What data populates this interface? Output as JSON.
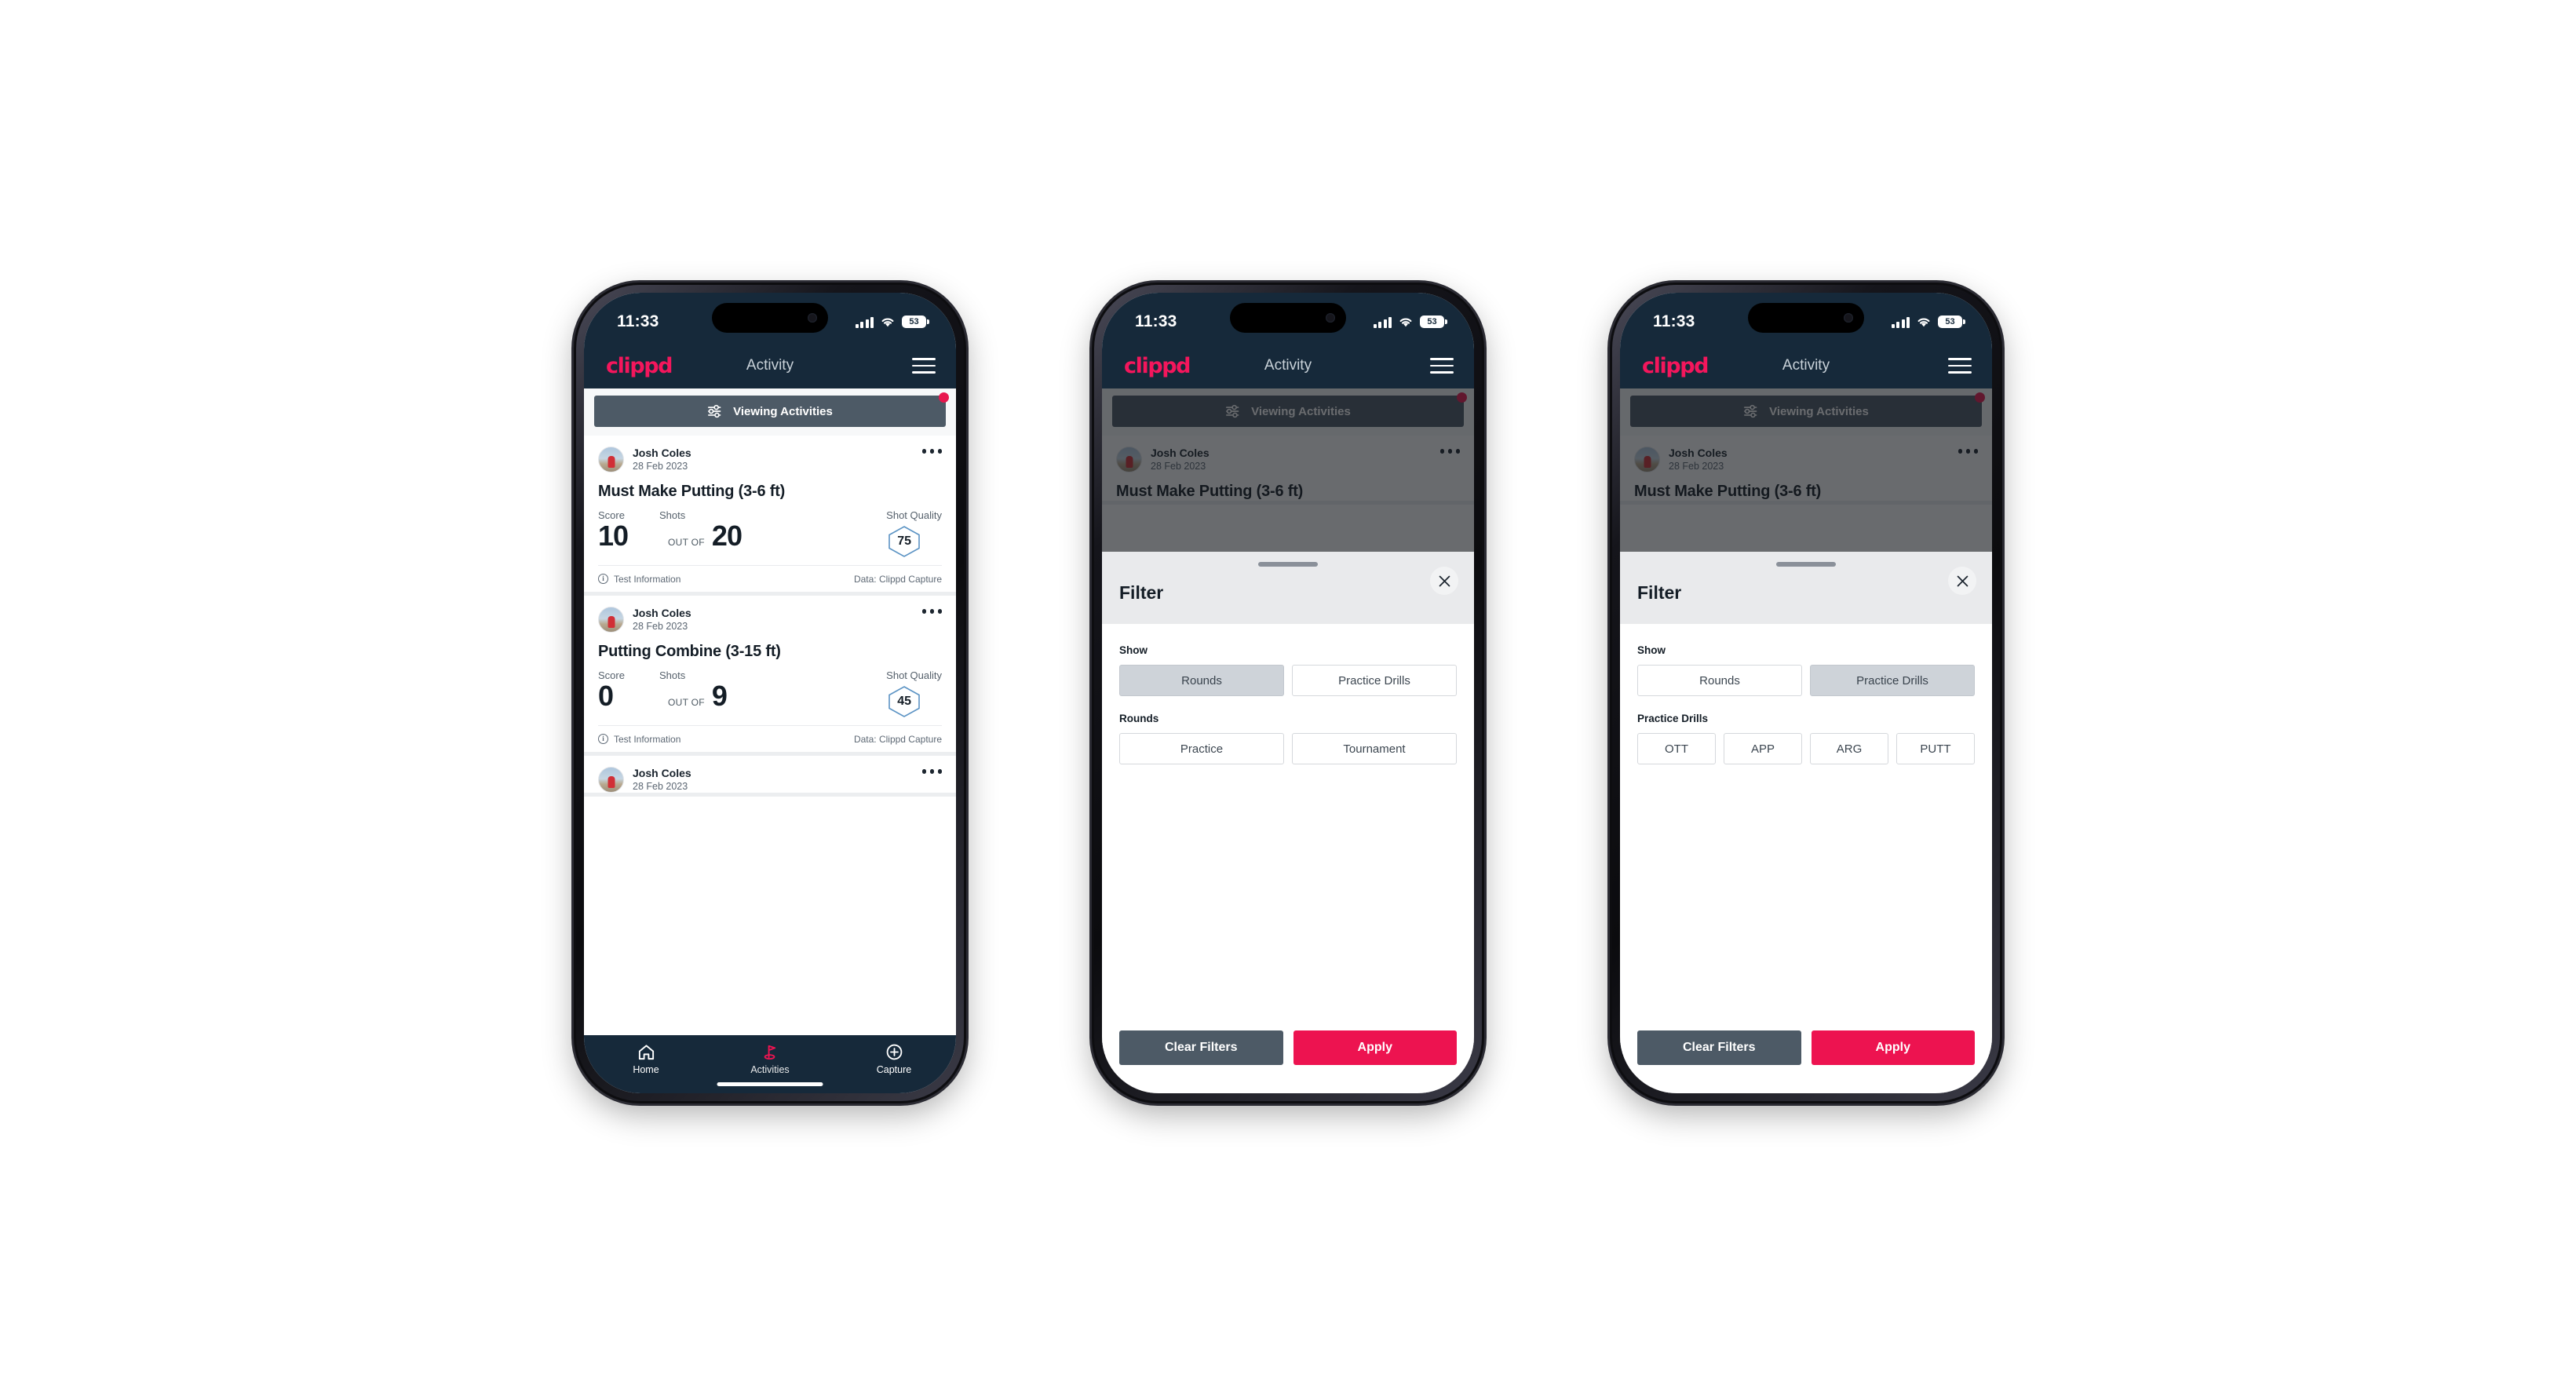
{
  "status_bar": {
    "time": "11:33",
    "battery_level": "53",
    "signal_icon": "cellular-signal-icon",
    "wifi_icon": "wifi-icon",
    "battery_icon": "battery-icon"
  },
  "app_header": {
    "brand": "clippd",
    "title": "Activity",
    "menu_icon": "hamburger-menu-icon"
  },
  "filter_bar": {
    "label": "Viewing Activities",
    "icon": "tune-sliders-icon",
    "has_notification_dot": true
  },
  "feed": {
    "cards": [
      {
        "user": "Josh Coles",
        "date": "28 Feb 2023",
        "title": "Must Make Putting (3-6 ft)",
        "score_label": "Score",
        "score_value": "10",
        "out_of_label": "OUT OF",
        "shots_label": "Shots",
        "shots_value": "20",
        "quality_label": "Shot Quality",
        "quality_value": "75",
        "footer_left": "Test Information",
        "footer_right": "Data: Clippd Capture"
      },
      {
        "user": "Josh Coles",
        "date": "28 Feb 2023",
        "title": "Putting Combine (3-15 ft)",
        "score_label": "Score",
        "score_value": "0",
        "out_of_label": "OUT OF",
        "shots_label": "Shots",
        "shots_value": "9",
        "quality_label": "Shot Quality",
        "quality_value": "45",
        "footer_left": "Test Information",
        "footer_right": "Data: Clippd Capture"
      },
      {
        "user": "Josh Coles",
        "date": "28 Feb 2023"
      }
    ]
  },
  "bottom_nav": {
    "items": [
      {
        "label": "Home",
        "icon": "home-icon",
        "active": false
      },
      {
        "label": "Activities",
        "icon": "golf-flag-icon",
        "active": true
      },
      {
        "label": "Capture",
        "icon": "plus-circle-icon",
        "active": false
      }
    ]
  },
  "filter_sheet": {
    "title": "Filter",
    "close_icon": "close-x-icon",
    "show_label": "Show",
    "show_options": [
      "Rounds",
      "Practice Drills"
    ],
    "rounds_label": "Rounds",
    "rounds_options": [
      "Practice",
      "Tournament"
    ],
    "drills_label": "Practice Drills",
    "drills_options": [
      "OTT",
      "APP",
      "ARG",
      "PUTT"
    ],
    "clear_label": "Clear Filters",
    "apply_label": "Apply",
    "state_rounds_selected": "Rounds",
    "state_drills_selected": "Practice Drills"
  },
  "colors": {
    "header_navy": "#16293a",
    "brand_pink": "#f4165c",
    "accent_pink": "#ed1350",
    "slate": "#4d5a66",
    "chip_selected": "#ced3d9"
  }
}
